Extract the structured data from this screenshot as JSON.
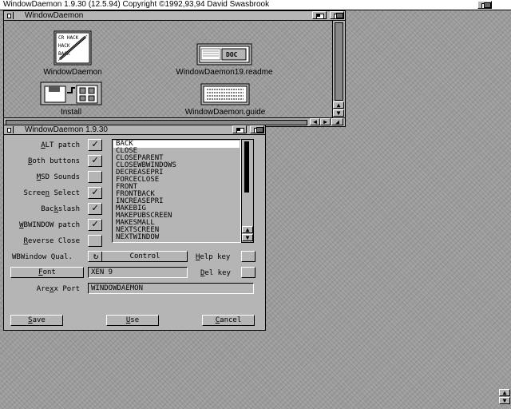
{
  "screen": {
    "title": "WindowDaemon 1.9.30 (12.5.94) Copyright ©1992,93,94 David Swasbrook"
  },
  "drawer_window": {
    "title": "WindowDaemon",
    "icons": [
      {
        "label": "WindowDaemon",
        "icon": "hackback-tool-icon"
      },
      {
        "label": "WindowDaemon19.readme",
        "icon": "doc-icon"
      },
      {
        "label": "Install",
        "icon": "install-disk-icon"
      },
      {
        "label": "WindowDaemon.guide",
        "icon": "guide-icon"
      }
    ],
    "doc_icon_text": "DOC",
    "tool_icon_text": [
      "CR HACK",
      "HACK",
      "BACK"
    ]
  },
  "prefs_window": {
    "title": "WindowDaemon 1.9.30",
    "checkboxes": [
      {
        "label": "ALT patch",
        "hot": "",
        "rest": "",
        "checked": true
      },
      {
        "label": "Both buttons",
        "checked": true
      },
      {
        "label": "MSD Sounds",
        "checked": false
      },
      {
        "label": "Screen Select",
        "checked": true
      },
      {
        "label": "Backslash",
        "checked": true
      },
      {
        "label": "WBWINDOW patch",
        "checked": true
      },
      {
        "label": "Reverse Close",
        "checked": false
      }
    ],
    "commands": [
      "BACK",
      "CLOSE",
      "CLOSEPARENT",
      "CLOSEWBWINDOWS",
      "DECREASEPRI",
      "FORCECLOSE",
      "FRONT",
      "FRONTBACK",
      "INCREASEPRI",
      "MAKEBIG",
      "MAKEPUBSCREEN",
      "MAKESMALL",
      "NEXTSCREEN",
      "NEXTWINDOW"
    ],
    "selected_command": "BACK",
    "wbwindow_qual_label": "WBWindow Qual.",
    "wbwindow_qual_value": "Control",
    "help_key_label": "Help key",
    "font_button": "Font",
    "font_value": "XEN 9",
    "del_key_label": "Del key",
    "arexx_label": "Arexx Port",
    "arexx_value": "WINDOWDAEMON",
    "save_button": "Save",
    "use_button": "Use",
    "cancel_button": "Cancel"
  }
}
